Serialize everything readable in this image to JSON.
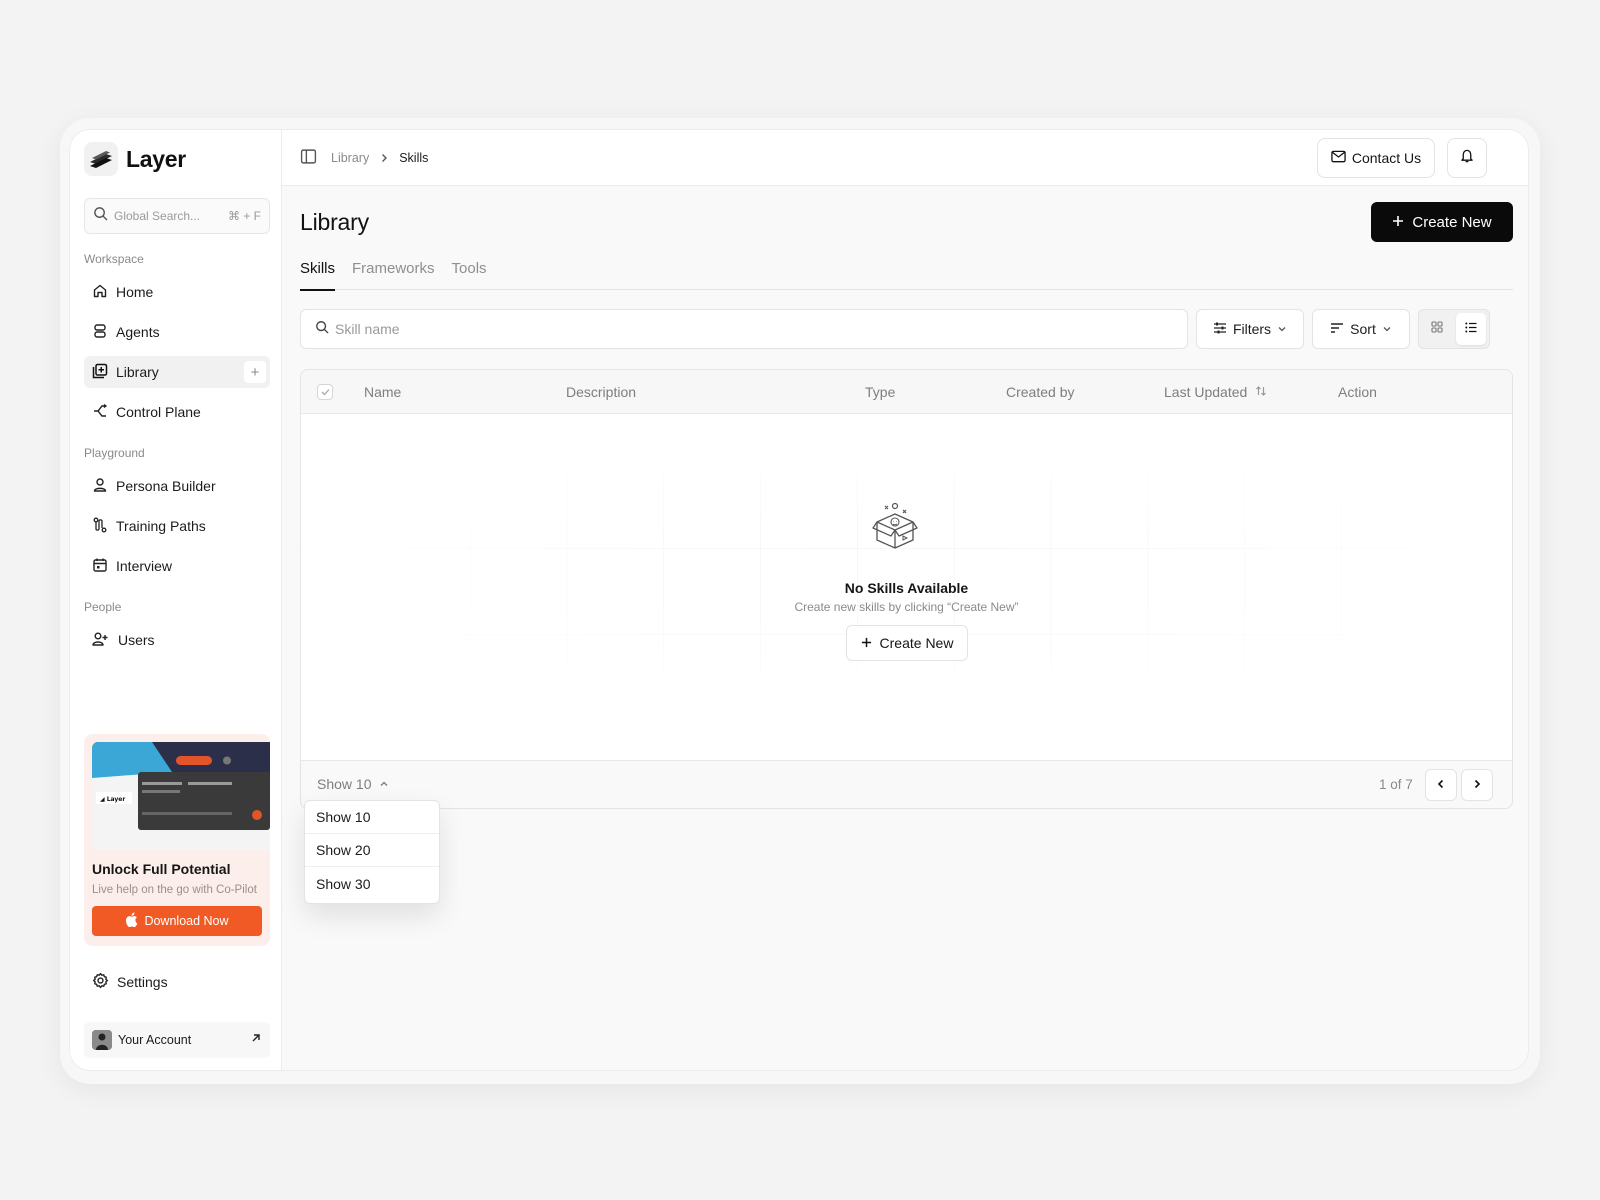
{
  "app": {
    "name": "Layer"
  },
  "search": {
    "placeholder": "Global Search...",
    "shortcut": "⌘ + F"
  },
  "sidebar": {
    "sections": [
      {
        "title": "Workspace"
      },
      {
        "title": "Playground"
      },
      {
        "title": "People"
      }
    ],
    "items": [
      {
        "label": "Home",
        "icon": "home-icon"
      },
      {
        "label": "Agents",
        "icon": "agents-icon"
      },
      {
        "label": "Library",
        "icon": "library-icon",
        "active": true
      },
      {
        "label": "Control Plane",
        "icon": "control-plane-icon"
      },
      {
        "label": "Persona Builder",
        "icon": "person-icon"
      },
      {
        "label": "Training Paths",
        "icon": "training-paths-icon"
      },
      {
        "label": "Interview",
        "icon": "calendar-icon"
      },
      {
        "label": "Users",
        "icon": "users-icon"
      }
    ],
    "settings_label": "Settings",
    "account_label": "Your Account"
  },
  "promo": {
    "title": "Unlock Full Potential",
    "subtitle": "Live help on the go with Co-Pilot",
    "button": "Download Now"
  },
  "breadcrumb": {
    "parent": "Library",
    "current": "Skills"
  },
  "header": {
    "contact_label": "Contact Us"
  },
  "page": {
    "title": "Library",
    "create_label": "Create New",
    "tabs": [
      "Skills",
      "Frameworks",
      "Tools"
    ],
    "active_tab": "Skills",
    "skill_search_placeholder": "Skill name",
    "filters_label": "Filters",
    "sort_label": "Sort"
  },
  "table": {
    "columns": [
      "Name",
      "Description",
      "Type",
      "Created by",
      "Last Updated",
      "Action"
    ],
    "empty_title": "No Skills Available",
    "empty_subtitle": "Create new skills by clicking “Create New”",
    "empty_button": "Create New"
  },
  "pagination": {
    "show_label": "Show 10",
    "page_text": "1 of 7",
    "options": [
      "Show 10",
      "Show 20",
      "Show 30"
    ]
  },
  "colors": {
    "accent": "#f15a24",
    "primary": "#0a0a0a",
    "promo_bg": "#fcefeb"
  }
}
